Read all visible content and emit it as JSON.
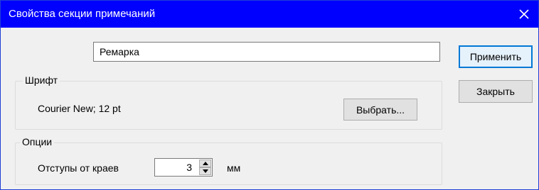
{
  "window": {
    "title": "Свойства секции примечаний"
  },
  "section_name": {
    "value": "Ремарка"
  },
  "font_group": {
    "legend": "Шрифт",
    "font_info": "Courier New; 12 pt",
    "choose_label": "Выбрать..."
  },
  "options_group": {
    "legend": "Опции",
    "margin_label": "Отступы от краев",
    "margin_value": "3",
    "unit_label": "мм"
  },
  "buttons": {
    "apply_label": "Применить",
    "close_label": "Закрыть"
  },
  "icons": {
    "close": "close-icon",
    "spin_up": "arrow-up-icon",
    "spin_down": "arrow-down-icon"
  },
  "colors": {
    "titlebar": "#0000ff",
    "accent": "#0078d7"
  }
}
